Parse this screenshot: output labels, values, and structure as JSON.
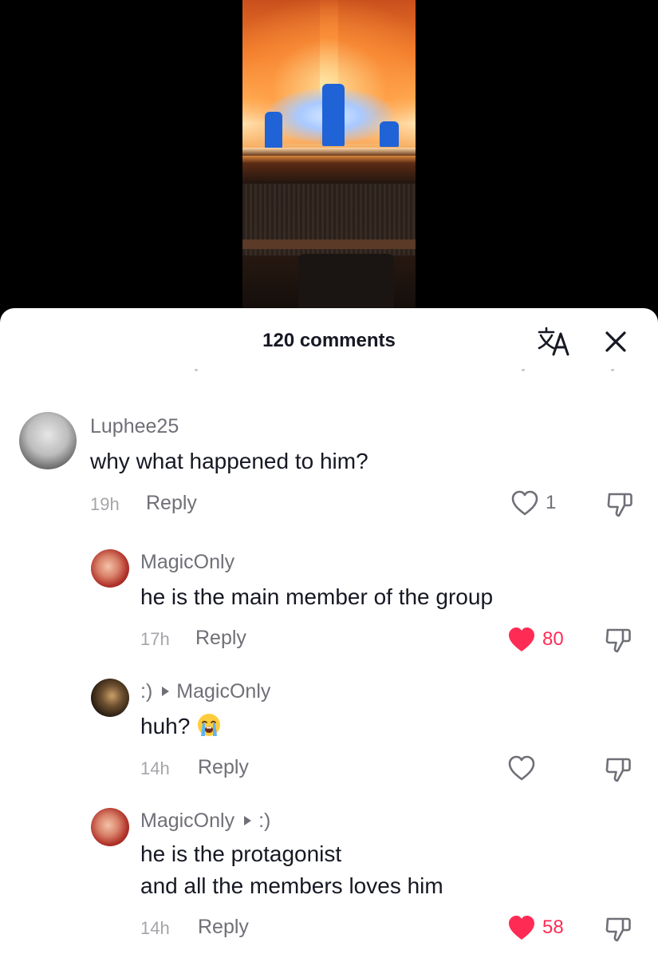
{
  "header": {
    "comment_count_label": "120 comments",
    "translate_icon": "translate-icon",
    "close_icon": "close-icon"
  },
  "colors": {
    "liked": "#fe2c55",
    "text_primary": "#161823",
    "text_secondary": "#6f7077"
  },
  "comments": [
    {
      "username": "Luphee25",
      "text": "why what happened to him?",
      "time": "19h",
      "reply_label": "Reply",
      "likes": "1",
      "liked": false
    },
    {
      "username": "MagicOnly",
      "text": "he is the main member of the group",
      "time": "17h",
      "reply_label": "Reply",
      "likes": "80",
      "liked": true
    },
    {
      "username": ":)",
      "reply_to": "MagicOnly",
      "text": "huh?",
      "emoji": "loudly-crying-face",
      "time": "14h",
      "reply_label": "Reply",
      "likes": "",
      "liked": false
    },
    {
      "username": "MagicOnly",
      "reply_to": ":)",
      "text_line1": "he is the protagonist",
      "text_line2": "and all the members loves him",
      "time": "14h",
      "reply_label": "Reply",
      "likes": "58",
      "liked": true
    }
  ]
}
